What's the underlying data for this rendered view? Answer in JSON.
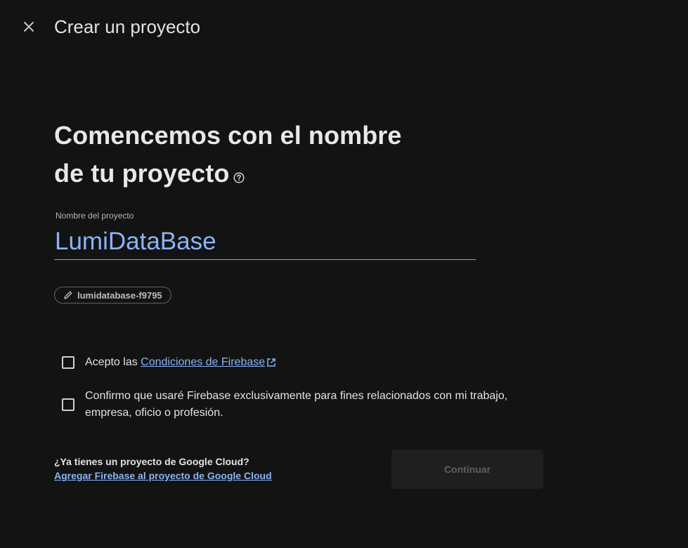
{
  "header": {
    "title": "Crear un proyecto"
  },
  "hero": {
    "line1": "Comencemos con el nombre",
    "line2": "de tu proyecto"
  },
  "project_name": {
    "label": "Nombre del proyecto",
    "value": "LumiDataBase"
  },
  "project_id": {
    "value": "lumidatabase-f9795"
  },
  "terms": {
    "prefix": "Acepto las ",
    "link": "Condiciones de Firebase"
  },
  "confirm": {
    "line1": "Confirmo que usaré Firebase exclusivamente para fines relacionados con mi trabajo,",
    "line2": "empresa, oficio o profesión."
  },
  "gcloud": {
    "question": "¿Ya tienes un proyecto de Google Cloud?",
    "link": "Agregar Firebase al proyecto de Google Cloud"
  },
  "actions": {
    "continue_label": "Continuar"
  },
  "colors": {
    "background": "#131313",
    "accent": "#8ab4f8",
    "disabled_button": "#1f1f1f"
  },
  "icons": [
    "close-icon",
    "help-icon",
    "pencil-icon",
    "external-link-icon"
  ]
}
